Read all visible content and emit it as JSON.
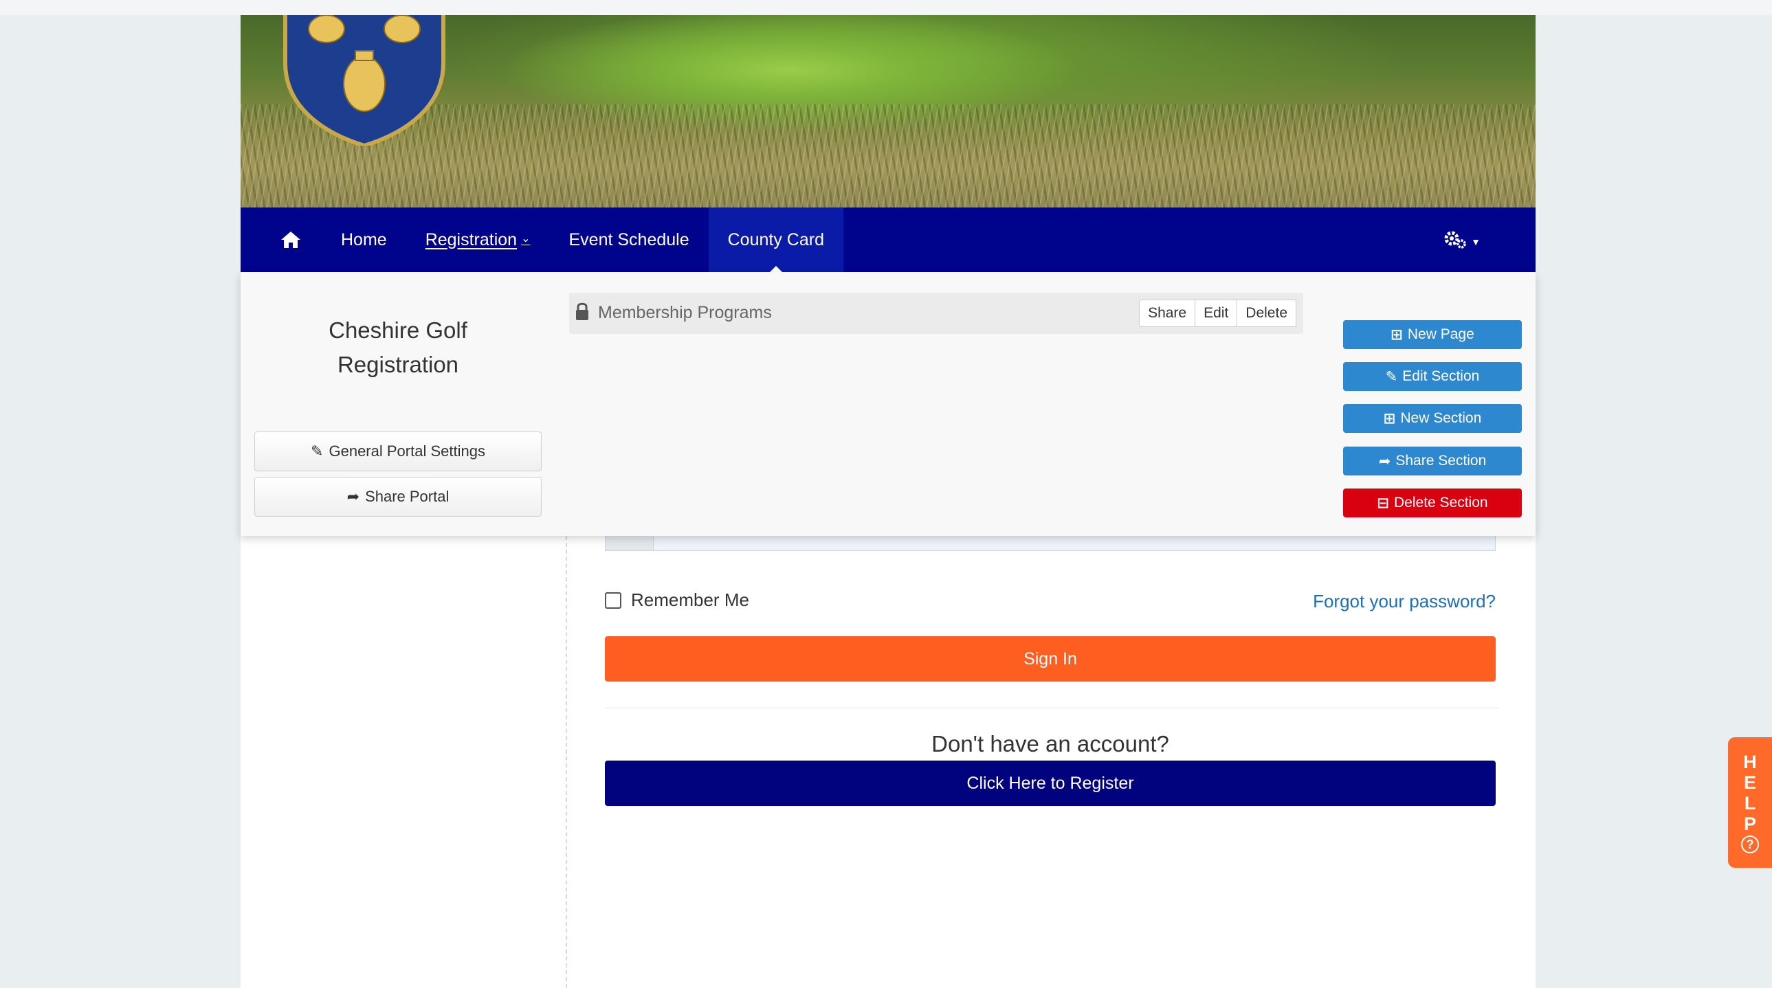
{
  "nav": {
    "home_icon": "home-icon",
    "items": [
      {
        "label": "Home"
      },
      {
        "label": "Registration"
      },
      {
        "label": "Event Schedule"
      },
      {
        "label": "County Card"
      }
    ],
    "active": "County Card",
    "settings_icon": "gears-icon"
  },
  "admin": {
    "portal_title_line1": "Cheshire Golf",
    "portal_title_line2": "Registration",
    "general_settings_label": "General Portal Settings",
    "share_portal_label": "Share Portal",
    "section": {
      "title": "Membership Programs",
      "share_label": "Share",
      "edit_label": "Edit",
      "delete_label": "Delete"
    },
    "actions": {
      "new_page": "New Page",
      "edit_section": "Edit Section",
      "new_section": "New Section",
      "share_section": "Share Section",
      "delete_section": "Delete Section"
    }
  },
  "login": {
    "remember_label": "Remember Me",
    "forgot_label": "Forgot your password?",
    "signin_label": "Sign In",
    "no_account_text": "Don't have an account?",
    "register_label": "Click Here to Register"
  },
  "help": {
    "letters": [
      "H",
      "E",
      "L",
      "P"
    ],
    "icon": "?"
  },
  "colors": {
    "nav_bg": "#00038c",
    "primary_blue": "#2d88cf",
    "danger_red": "#d9000f",
    "signin_orange": "#ff5e21",
    "register_navy": "#00037d",
    "help_orange": "#ff6a2a",
    "link_blue": "#1b6fb8"
  }
}
